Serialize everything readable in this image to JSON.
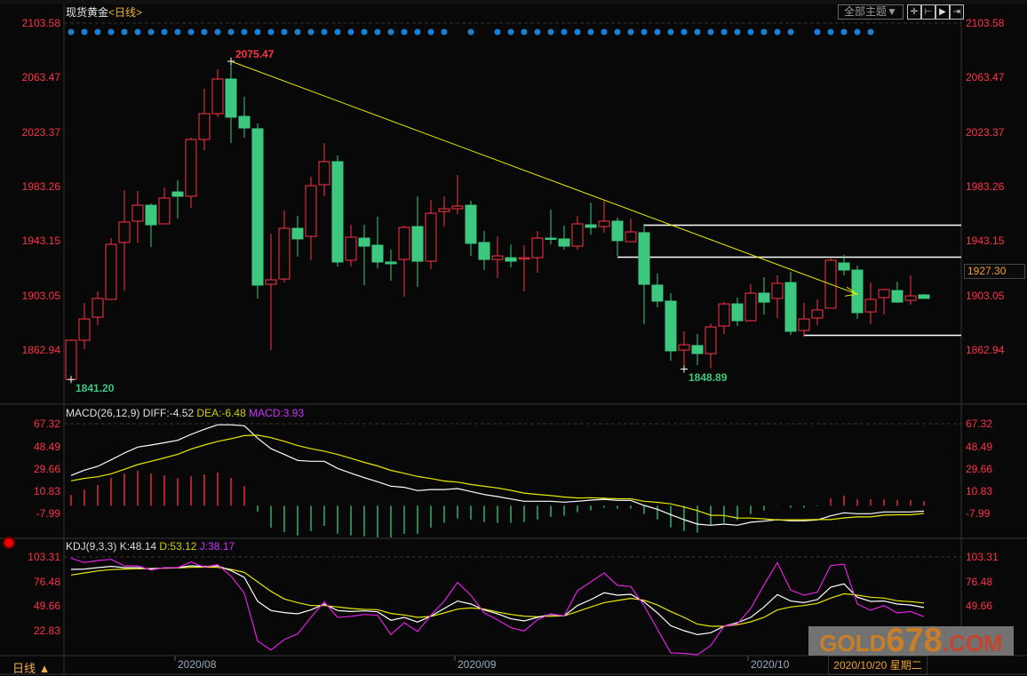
{
  "header": {
    "instrument": "现货黄金",
    "period": "<日线>",
    "theme_button": "全部主题▼",
    "toolbar_icons": [
      "crosshair-icon",
      "range-start-icon",
      "play-icon",
      "range-end-icon"
    ]
  },
  "current_price_box": "1927.30",
  "macd_header": {
    "name": "MACD(26,12,9)",
    "diff": "DIFF:-4.52",
    "dea": "DEA:-6.48",
    "macd": "MACD:3.93"
  },
  "kdj_header": {
    "name": "KDJ(9,3,3)",
    "k": "K:48.14",
    "d": "D:53.12",
    "j": "J:38.17"
  },
  "bottom_bar": {
    "period_label": "日线 ▲",
    "cursor_date": "2020/10/20 星期二"
  },
  "watermark": {
    "part1": "GOLD",
    "part2": "678",
    "part3": ".COM"
  },
  "colors": {
    "up": "#ff3344",
    "down": "#3cc87e",
    "diff": "#ffffff",
    "dea": "#e8e800",
    "macd_label": "#cc33ff",
    "j": "#e020e0",
    "dots": "#1a7fd0",
    "trendline": "#e8e800",
    "axis_text": "#ff3344"
  },
  "chart_data": [
    {
      "type": "candlestick",
      "title": "现货黄金 日线",
      "x_labels": [
        {
          "index": 8,
          "label": "2020/08"
        },
        {
          "index": 29,
          "label": "2020/09"
        },
        {
          "index": 51,
          "label": "2020/10"
        }
      ],
      "price_ticks": [
        "2103.58",
        "2063.47",
        "2023.37",
        "1983.26",
        "1943.15",
        "1903.05",
        "1862.94"
      ],
      "ylim": [
        1862.94,
        2103.58
      ],
      "open": [
        1841.2,
        1870.1,
        1887.1,
        1900.2,
        1942.1,
        1957.8,
        1969.5,
        1955.8,
        1979.3,
        1976.1,
        2017.9,
        2036.9,
        2062.4,
        2034.9,
        2025.8,
        1911.3,
        1915.2,
        1952.5,
        1946.6,
        1984.6,
        2001.6,
        1929.0,
        1945.3,
        1940.1,
        1927.7,
        1929.6,
        1953.8,
        1928.3,
        1964.9,
        1966.9,
        1969.5,
        1942.1,
        1929.6,
        1930.9,
        1930.3,
        1930.9,
        1945.3,
        1944.7,
        1939.4,
        1955.1,
        1953.8,
        1957.8,
        1942.7,
        1949.3,
        1910.7,
        1898.9,
        1862.9,
        1866.2,
        1860.3,
        1880.6,
        1896.9,
        1884.5,
        1904.8,
        1900.9,
        1912.6,
        1877.3,
        1886.5,
        1893.7,
        1927.0,
        1921.8,
        1891.0,
        1901.5,
        1906.7,
        1899.5,
        1903.5
      ],
      "high": [
        1870.8,
        1897.6,
        1906.1,
        1945.3,
        1980.6,
        1980.0,
        1970.8,
        1982.6,
        1987.8,
        2019.2,
        2055.2,
        2069.6,
        2075.47,
        2049.3,
        2029.7,
        1948.6,
        1965.6,
        1961.7,
        1990.5,
        2015.3,
        2006.1,
        1955.1,
        1955.1,
        1961.0,
        1936.8,
        1954.5,
        1976.1,
        1973.4,
        1976.1,
        1991.8,
        1972.8,
        1950.6,
        1946.6,
        1940.7,
        1940.1,
        1950.6,
        1966.3,
        1954.5,
        1961.7,
        1971.5,
        1972.8,
        1960.4,
        1959.7,
        1955.8,
        1919.2,
        1904.8,
        1876.7,
        1874.7,
        1882.5,
        1898.2,
        1901.5,
        1911.3,
        1916.6,
        1917.9,
        1920.5,
        1897.6,
        1900.2,
        1930.3,
        1932.9,
        1925.1,
        1912.6,
        1908.0,
        1913.3,
        1917.9,
        1904.1
      ],
      "low": [
        1841.2,
        1863.6,
        1881.2,
        1900.2,
        1906.7,
        1942.1,
        1938.8,
        1955.8,
        1959.7,
        1967.6,
        2010.1,
        2034.3,
        2015.3,
        2019.2,
        1900.9,
        1862.9,
        1912.6,
        1931.6,
        1929.0,
        1976.1,
        1924.4,
        1924.4,
        1910.7,
        1923.1,
        1913.9,
        1902.2,
        1909.4,
        1922.4,
        1953.8,
        1963.0,
        1932.2,
        1921.8,
        1915.9,
        1923.7,
        1906.1,
        1919.8,
        1940.7,
        1936.8,
        1936.8,
        1947.9,
        1949.3,
        1932.2,
        1942.7,
        1881.9,
        1894.3,
        1855.1,
        1848.89,
        1851.8,
        1849.5,
        1874.7,
        1880.6,
        1883.9,
        1889.1,
        1886.5,
        1874.0,
        1872.7,
        1881.2,
        1893.7,
        1917.9,
        1885.8,
        1881.9,
        1889.1,
        1897.6,
        1896.3,
        1900.9
      ],
      "close": [
        1870.1,
        1885.8,
        1900.9,
        1940.7,
        1957.1,
        1969.5,
        1955.1,
        1974.8,
        1976.1,
        2017.9,
        2036.9,
        2062.4,
        2034.3,
        2026.4,
        1910.7,
        1914.6,
        1952.5,
        1944.7,
        1983.9,
        2001.6,
        1927.7,
        1946.0,
        1939.4,
        1927.7,
        1926.4,
        1953.2,
        1928.3,
        1963.6,
        1966.9,
        1968.9,
        1941.4,
        1929.6,
        1932.2,
        1928.3,
        1930.9,
        1945.3,
        1944.9,
        1939.4,
        1955.8,
        1953.2,
        1957.8,
        1943.4,
        1949.9,
        1911.3,
        1898.9,
        1862.3,
        1866.8,
        1860.3,
        1879.9,
        1896.9,
        1884.5,
        1904.8,
        1898.2,
        1912.0,
        1876.7,
        1885.8,
        1892.4,
        1929.0,
        1921.8,
        1890.4,
        1900.2,
        1907.4,
        1898.2,
        1902.8,
        1900.9
      ],
      "signal_dots": [
        1,
        1,
        1,
        1,
        1,
        1,
        1,
        1,
        1,
        1,
        1,
        1,
        1,
        1,
        1,
        1,
        1,
        1,
        1,
        1,
        1,
        1,
        1,
        1,
        1,
        1,
        1,
        1,
        1,
        0,
        1,
        0,
        1,
        1,
        1,
        1,
        1,
        1,
        1,
        1,
        1,
        1,
        1,
        1,
        1,
        1,
        1,
        1,
        1,
        1,
        1,
        1,
        1,
        1,
        1,
        0,
        1,
        1,
        1,
        1,
        1,
        0,
        0,
        0,
        0
      ],
      "annotations": [
        {
          "index": 12,
          "value": "2075.47",
          "kind": "high"
        },
        {
          "index": 0,
          "value": "1841.20",
          "kind": "low"
        },
        {
          "index": 46,
          "value": "1848.89",
          "kind": "low"
        }
      ],
      "trendline": {
        "from": {
          "index": 12,
          "price": 2075.47
        },
        "to": {
          "index": 59,
          "price": 1904.0
        }
      },
      "horizontal_lines": [
        {
          "from_index": 43,
          "price": 1955.1
        },
        {
          "from_index": 41,
          "price": 1931.6
        },
        {
          "from_index": 55,
          "price": 1874.0
        }
      ]
    },
    {
      "type": "bar+line",
      "title": "MACD(26,12,9)",
      "ticks": [
        "67.32",
        "48.49",
        "29.66",
        "10.83",
        "-7.99"
      ],
      "ylim": [
        -7.99,
        67.32
      ],
      "diff": [
        25.4,
        29.8,
        33.0,
        38.5,
        44.2,
        49.2,
        50.9,
        52.9,
        54.9,
        59.9,
        64.1,
        67.9,
        67.9,
        67.1,
        56.7,
        47.9,
        43.0,
        38.0,
        37.3,
        37.3,
        31.3,
        27.3,
        23.6,
        20.1,
        16.4,
        15.4,
        12.7,
        13.6,
        13.6,
        14.4,
        11.9,
        9.4,
        7.7,
        5.7,
        3.7,
        3.7,
        3.7,
        3.0,
        3.7,
        4.7,
        5.4,
        4.5,
        4.5,
        0.2,
        -3.0,
        -7.5,
        -11.7,
        -15.4,
        -16.4,
        -15.4,
        -16.4,
        -13.9,
        -13.0,
        -11.7,
        -12.7,
        -12.7,
        -11.9,
        -8.5,
        -6.0,
        -6.7,
        -6.7,
        -5.2,
        -5.2,
        -5.2,
        -4.52
      ],
      "dea": [
        20.9,
        23.0,
        24.3,
        26.8,
        30.6,
        34.5,
        37.3,
        40.1,
        43.2,
        47.5,
        50.9,
        54.0,
        56.2,
        58.8,
        59.2,
        57.1,
        54.1,
        50.5,
        47.9,
        45.8,
        43.0,
        39.8,
        36.4,
        33.4,
        29.7,
        27.2,
        24.5,
        22.8,
        20.7,
        19.8,
        17.8,
        16.3,
        14.9,
        12.9,
        10.6,
        9.5,
        8.5,
        7.3,
        6.5,
        6.7,
        6.3,
        5.8,
        5.8,
        3.7,
        2.8,
        1.6,
        -1.1,
        -4.1,
        -8.0,
        -8.2,
        -10.3,
        -10.4,
        -11.0,
        -11.9,
        -11.8,
        -11.8,
        -11.6,
        -11.6,
        -10.2,
        -9.4,
        -9.4,
        -7.9,
        -7.6,
        -7.6,
        -6.48
      ],
      "macd": [
        9.0,
        13.6,
        17.4,
        23.3,
        27.1,
        29.3,
        27.1,
        25.6,
        23.3,
        24.8,
        26.3,
        27.8,
        23.3,
        16.6,
        -5.0,
        -18.4,
        -22.1,
        -24.9,
        -21.2,
        -16.9,
        -23.4,
        -24.9,
        -25.6,
        -26.6,
        -26.6,
        -23.6,
        -23.6,
        -18.4,
        -14.2,
        -10.7,
        -11.7,
        -13.7,
        -14.4,
        -14.4,
        -13.7,
        -11.5,
        -9.5,
        -8.5,
        -5.5,
        -4.0,
        -1.8,
        -2.5,
        -2.5,
        -7.0,
        -11.5,
        -18.2,
        -21.2,
        -22.6,
        -16.7,
        -14.4,
        -12.2,
        -7.0,
        -4.0,
        0.3,
        -1.8,
        -1.8,
        -0.5,
        6.2,
        8.4,
        5.4,
        5.4,
        5.4,
        4.7,
        4.7,
        3.93
      ]
    },
    {
      "type": "line",
      "title": "KDJ(9,3,3)",
      "ticks": [
        "103.31",
        "76.48",
        "49.66",
        "22.83"
      ],
      "ylim": [
        22.83,
        103.31
      ],
      "k": [
        89.7,
        90.1,
        91.7,
        93.0,
        91.7,
        91.7,
        90.1,
        91.4,
        91.7,
        93.6,
        93.0,
        93.6,
        88.5,
        81.0,
        54.8,
        44.8,
        42.6,
        41.3,
        45.5,
        51.9,
        44.8,
        43.8,
        44.5,
        43.5,
        34.2,
        37.4,
        32.2,
        38.7,
        47.1,
        55.2,
        51.9,
        45.5,
        41.3,
        35.8,
        33.5,
        37.4,
        40.6,
        39.0,
        50.3,
        56.8,
        64.2,
        61.6,
        62.6,
        54.2,
        42.2,
        28.3,
        22.8,
        18.6,
        20.6,
        27.7,
        31.6,
        37.4,
        48.7,
        62.3,
        55.2,
        53.5,
        56.8,
        70.3,
        73.9,
        59.4,
        54.8,
        55.2,
        51.9,
        50.9,
        48.14
      ],
      "d": [
        83.6,
        85.9,
        88.1,
        89.4,
        90.1,
        90.4,
        90.7,
        91.0,
        91.4,
        92.0,
        92.3,
        92.0,
        89.7,
        86.5,
        76.2,
        65.8,
        57.4,
        53.5,
        50.3,
        50.3,
        48.7,
        47.1,
        46.1,
        45.8,
        41.6,
        40.0,
        37.4,
        38.4,
        42.2,
        46.4,
        47.7,
        46.4,
        43.2,
        40.6,
        38.7,
        38.0,
        38.7,
        39.0,
        43.8,
        48.7,
        53.5,
        55.8,
        58.1,
        56.1,
        50.9,
        43.8,
        37.4,
        30.0,
        27.7,
        27.7,
        29.3,
        32.5,
        37.4,
        45.5,
        48.7,
        50.3,
        52.6,
        58.4,
        63.2,
        61.6,
        59.4,
        58.4,
        55.5,
        54.5,
        53.12
      ],
      "j": [
        102.0,
        97.2,
        99.4,
        100.7,
        93.6,
        93.6,
        89.1,
        91.7,
        91.7,
        97.8,
        92.3,
        94.9,
        82.6,
        63.9,
        11.5,
        1.8,
        13.1,
        19.3,
        37.4,
        54.2,
        37.4,
        38.4,
        40.6,
        39.6,
        18.6,
        31.6,
        21.9,
        39.6,
        55.2,
        75.5,
        61.6,
        42.2,
        34.8,
        26.1,
        22.5,
        34.8,
        41.3,
        39.0,
        66.4,
        76.2,
        85.9,
        72.3,
        71.0,
        50.3,
        24.5,
        -1.4,
        -2.0,
        -4.6,
        6.6,
        27.7,
        30.3,
        47.1,
        72.9,
        97.2,
        67.1,
        61.6,
        64.9,
        93.9,
        95.6,
        51.9,
        45.1,
        50.3,
        42.2,
        43.8,
        38.17
      ]
    }
  ]
}
